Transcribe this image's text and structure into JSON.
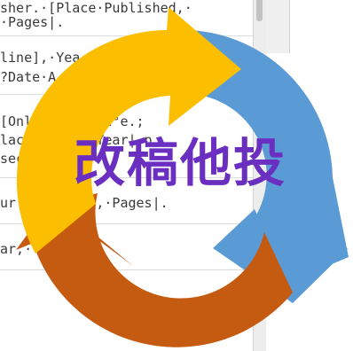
{
  "document": {
    "lines": [
      "sher.·[Place·Published,·",
      "·Pages|.",
      "line],·Yea",
      "?Date·A",
      "[Onl        on°e.;",
      "lac         Year|·p",
      "sec",
      "ur        )],·Pages|.",
      "ar,·"
    ]
  },
  "overlay": {
    "title": "改稿他投"
  },
  "colors": {
    "arrow_yellow": "#fbbe00",
    "arrow_blue": "#5b9bd5",
    "arrow_orange": "#c55a11",
    "title_purple": "#6a2fc0"
  },
  "icons": {
    "cycle": "circular-refresh-arrows-icon"
  }
}
